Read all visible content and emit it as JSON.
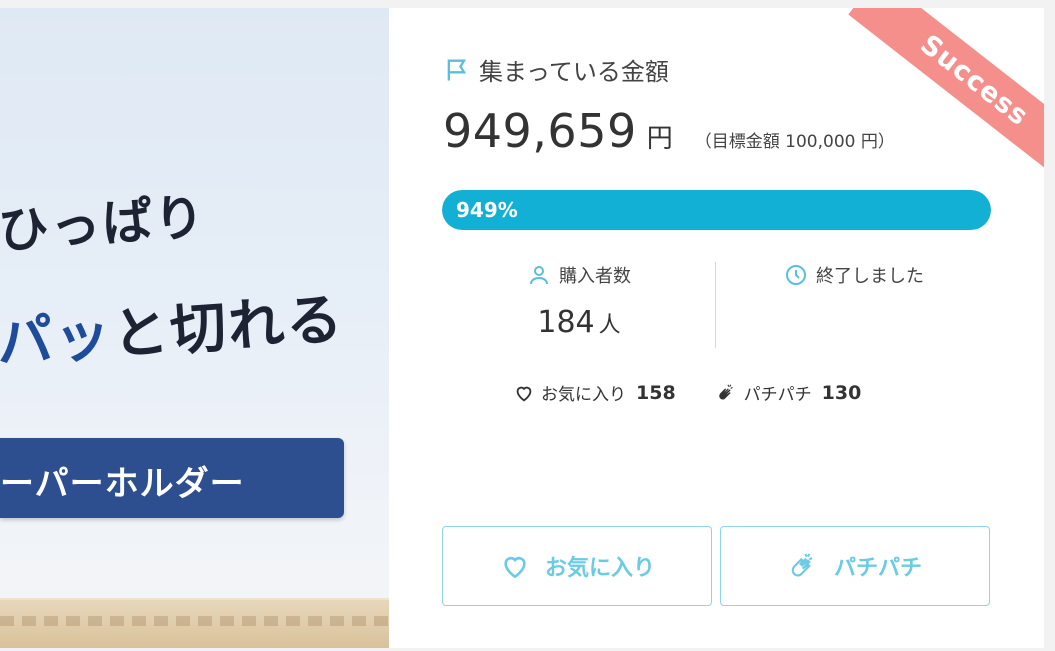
{
  "hero": {
    "line1": "ひっぱり",
    "line2_accent": "パッ",
    "line2_rest": "と切れる",
    "banner": "ーパーホルダー"
  },
  "funding": {
    "title": "集まっている金額",
    "amount": "949,659",
    "currency": "円",
    "goal_text": "（目標金額 100,000 円）",
    "progress_label": "949%",
    "progress_percent": 949,
    "badge": "Success"
  },
  "stats": {
    "buyers_label": "購入者数",
    "buyers_value": "184",
    "buyers_unit": "人",
    "status_label": "終了しました"
  },
  "social": {
    "favorite_label": "お気に入り",
    "favorite_count": "158",
    "clap_label": "パチパチ",
    "clap_count": "130"
  },
  "actions": {
    "favorite_button": "お気に入り",
    "clap_button": "パチパチ"
  },
  "colors": {
    "accent": "#12b0d5",
    "badge": "#f58f8c",
    "button_border": "#8fd4e8",
    "button_text": "#6ccbe4"
  }
}
